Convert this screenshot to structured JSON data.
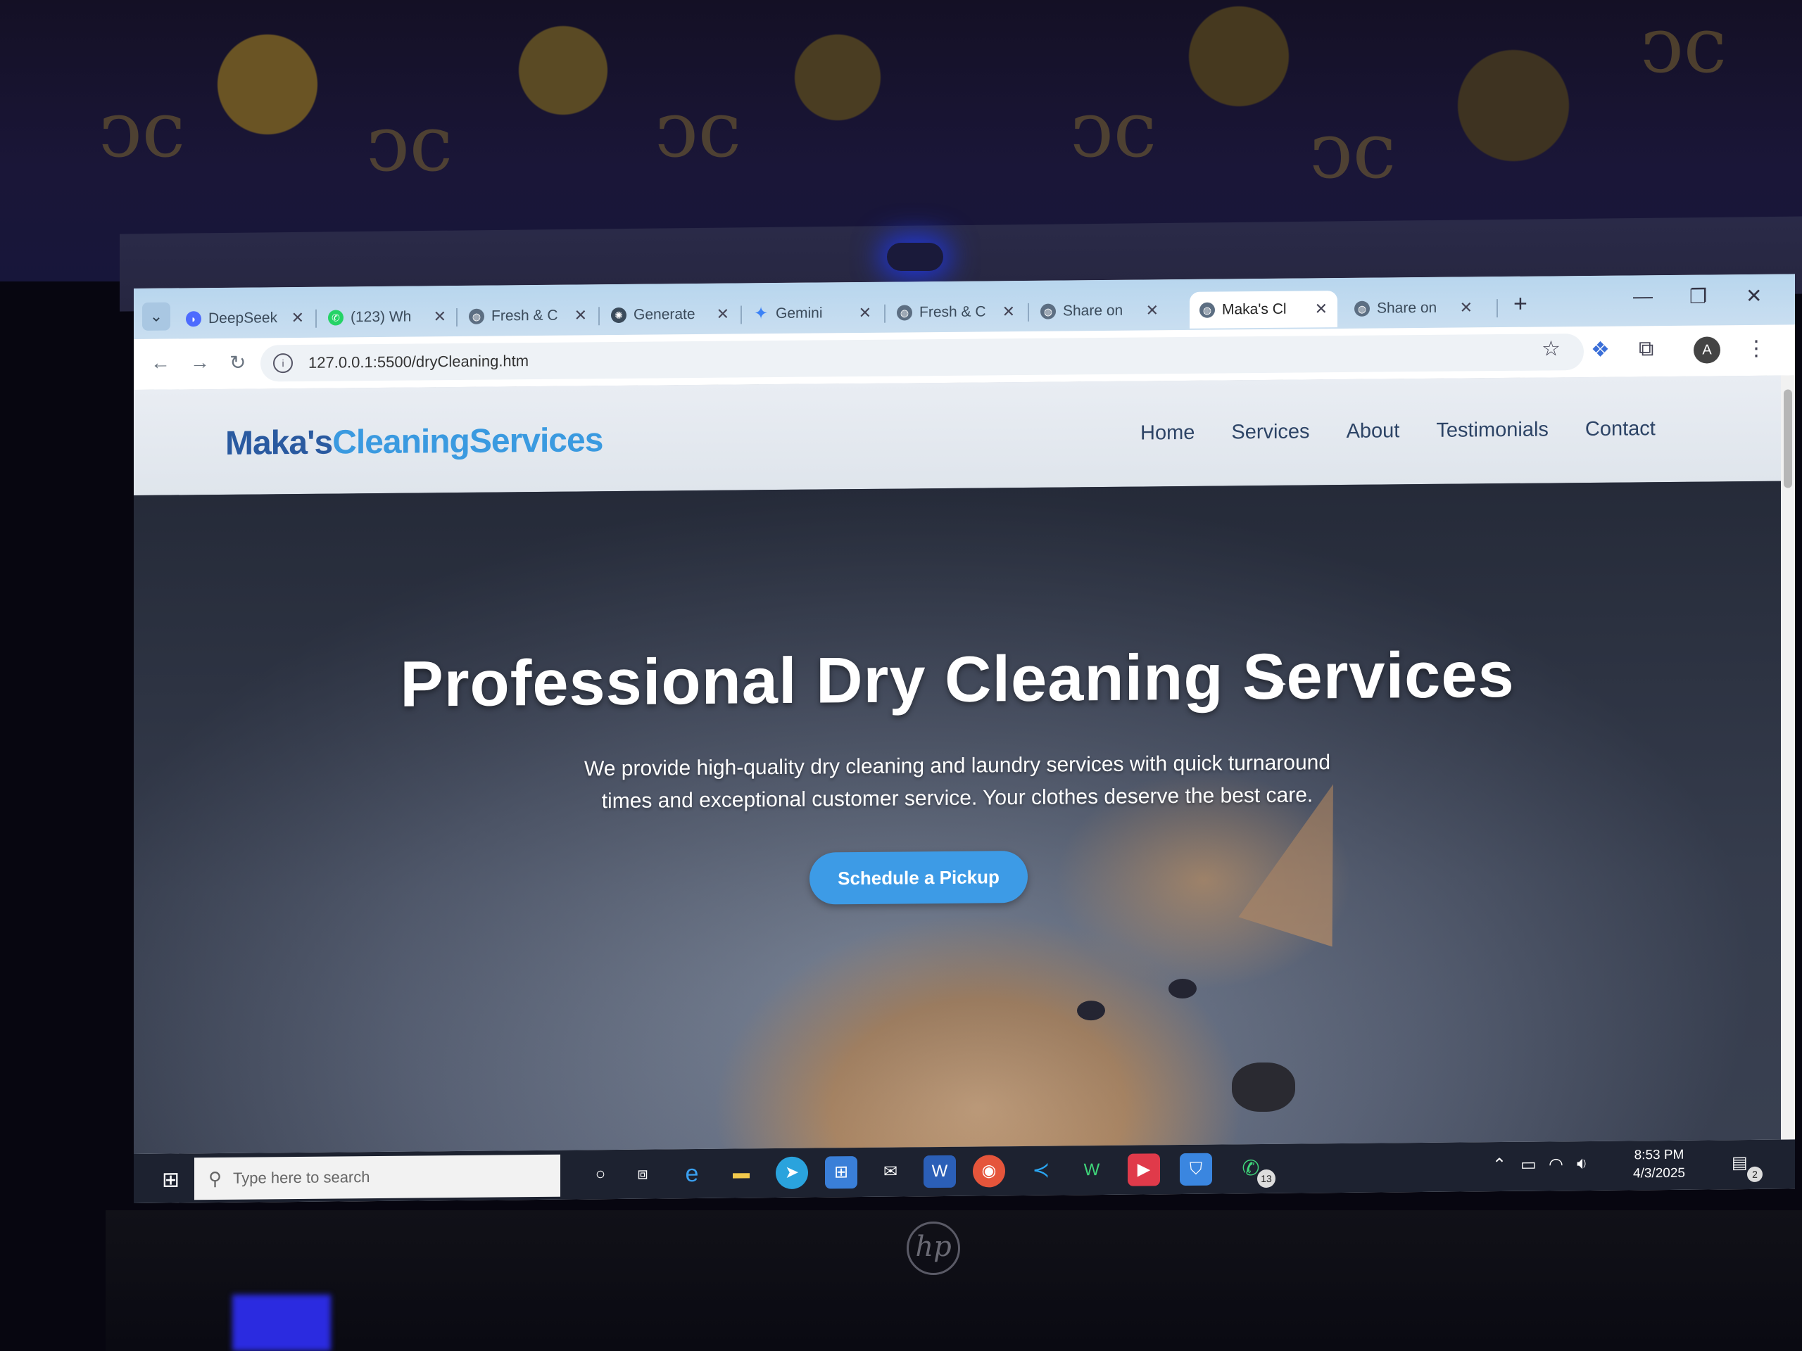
{
  "browser": {
    "tabs": [
      {
        "title": "DeepSeek",
        "icon": "deepseek-icon"
      },
      {
        "title": "(123) Wh",
        "icon": "whatsapp-icon"
      },
      {
        "title": "Fresh & C",
        "icon": "globe-icon"
      },
      {
        "title": "Generate",
        "icon": "openai-icon"
      },
      {
        "title": "Gemini",
        "icon": "gemini-icon"
      },
      {
        "title": "Fresh & C",
        "icon": "globe-icon"
      },
      {
        "title": "Share on",
        "icon": "globe-icon"
      },
      {
        "title": "Maka's Cl",
        "icon": "globe-icon",
        "active": true
      },
      {
        "title": "Share on",
        "icon": "globe-icon"
      }
    ],
    "new_tab_label": "+",
    "url": "127.0.0.1:5500/dryCleaning.htm",
    "profile_initial": "A"
  },
  "site": {
    "logo_part1": "Maka's",
    "logo_part2": "CleaningServices",
    "nav": [
      "Home",
      "Services",
      "About",
      "Testimonials",
      "Contact"
    ],
    "hero_title": "Professional Dry Cleaning Services",
    "hero_text": "We provide high-quality dry cleaning and laundry services with quick turnaround times and exceptional customer service. Your clothes deserve the best care.",
    "cta_label": "Schedule a Pickup"
  },
  "taskbar": {
    "search_placeholder": "Type here to search",
    "whatsapp_badge": "13",
    "time": "8:53 PM",
    "date": "4/3/2025",
    "notification_count": "2"
  },
  "device": {
    "brand": "hp"
  },
  "colors": {
    "logo_dark": "#2a5aa0",
    "logo_light": "#3a9ae0",
    "nav_text": "#2d4466",
    "cta_bg": "#3d9be6",
    "tabstrip": "#b8d6ee",
    "taskbar": "#1d2230"
  }
}
